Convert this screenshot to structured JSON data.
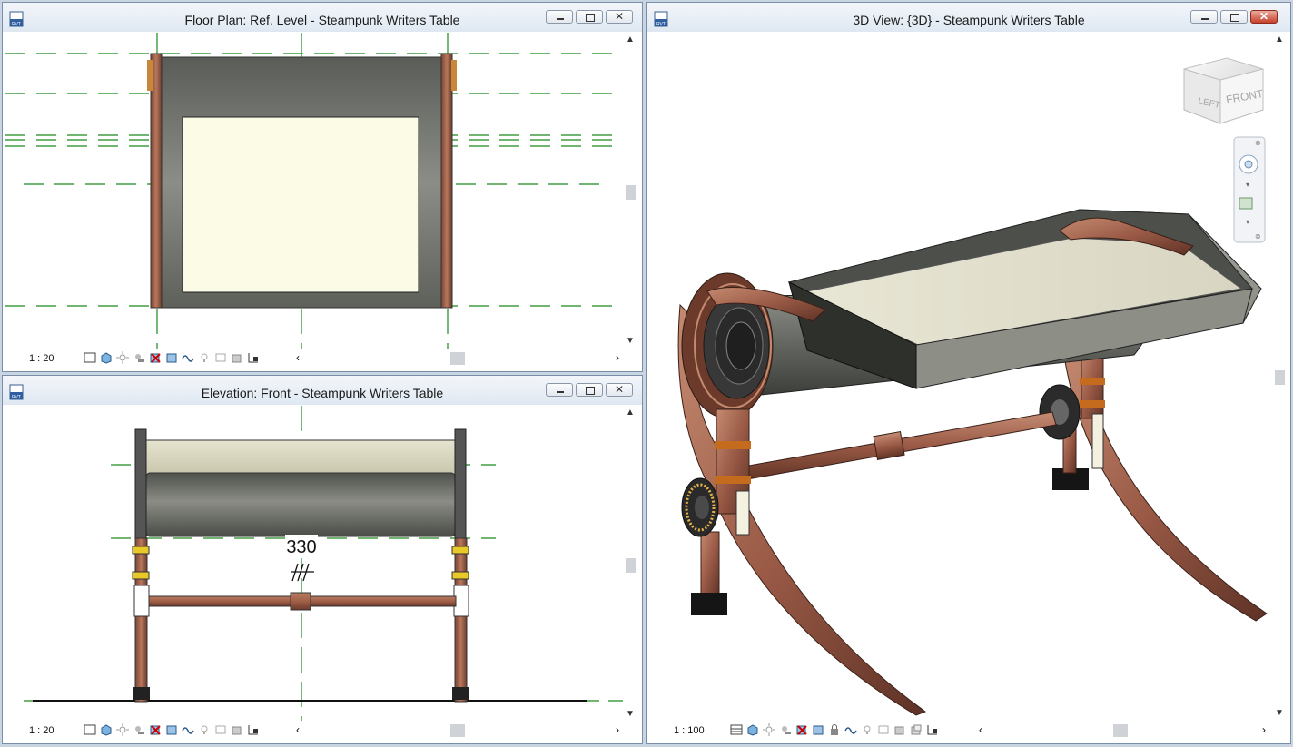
{
  "windows": {
    "floor_plan": {
      "title": "Floor Plan: Ref. Level - Steampunk Writers Table",
      "scale": "1 : 20"
    },
    "elevation": {
      "title": "Elevation: Front - Steampunk Writers Table",
      "scale": "1 : 20",
      "dimension": "330"
    },
    "view3d": {
      "title": "3D View: {3D} - Steampunk Writers Table",
      "scale": "1 : 100",
      "viewcube": {
        "left_label": "LEFT",
        "front_label": "FRONT"
      }
    }
  },
  "window_buttons": {
    "close": "✕"
  },
  "icons": {
    "file_icon": "rvt-file-icon",
    "vcb": [
      "detail-level-icon",
      "visual-style-icon",
      "sun-path-icon",
      "shadows-icon",
      "crop-view-icon",
      "show-crop-icon",
      "temp-hide-icon",
      "reveal-hidden-icon",
      "analysis-icon",
      "highlight-displacement-icon",
      "lock-3d-icon"
    ]
  },
  "colors": {
    "frame_bg": "#c9d5e3",
    "titlebar": "#dfe8f2",
    "ref_plane": "#1b8a1b",
    "copper": "#9a5a46",
    "drum_gray": "#6d6f6a",
    "top_cream": "#fbfbe6",
    "close_red": "#c7412c"
  }
}
